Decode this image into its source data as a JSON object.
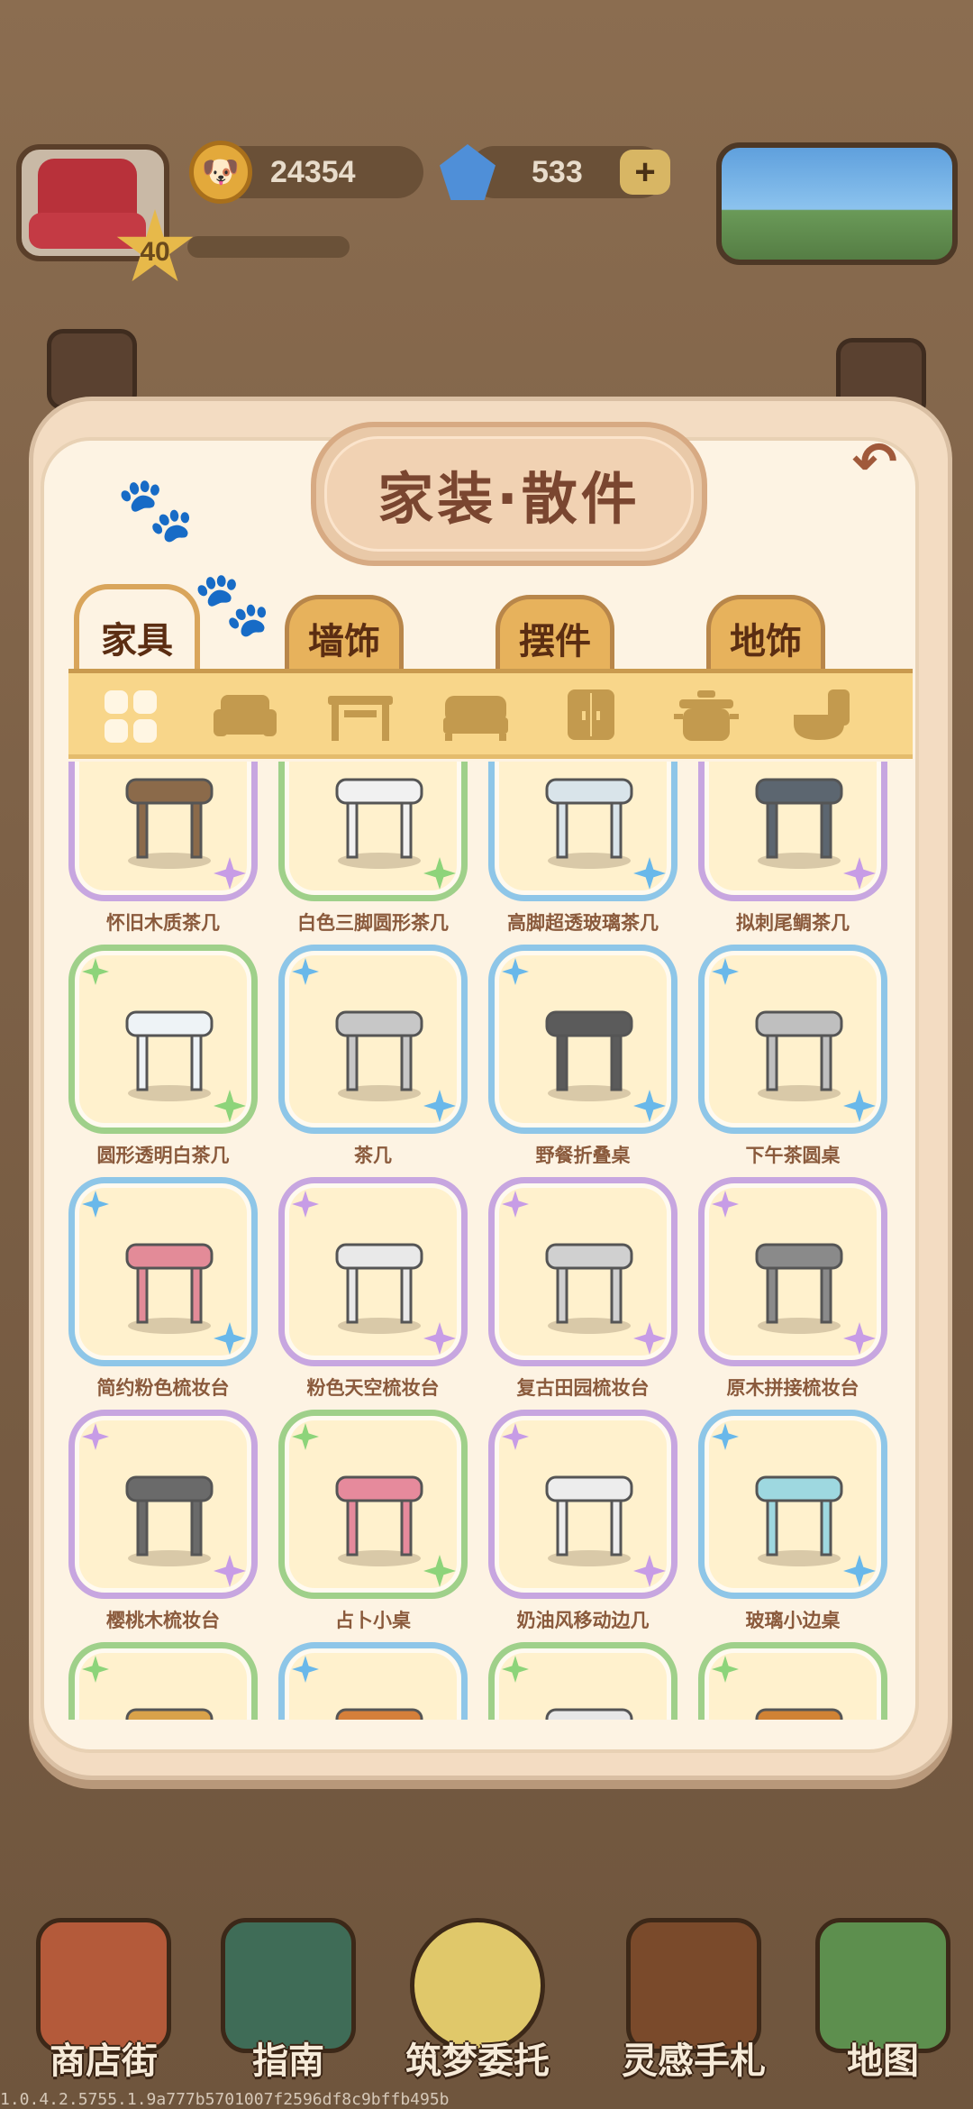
{
  "hud": {
    "level": "40",
    "coins": "24354",
    "gems": "533",
    "icons": {
      "avatar": "armchair-avatar",
      "coin": "dog-coin-icon",
      "gem": "diamond-icon",
      "plus": "plus-icon"
    }
  },
  "panel": {
    "title": "家装·散件",
    "back_icon": "undo-arrow-icon",
    "tabs": [
      {
        "label": "家具",
        "active": true
      },
      {
        "label": "墙饰",
        "active": false
      },
      {
        "label": "摆件",
        "active": false
      },
      {
        "label": "地饰",
        "active": false
      }
    ],
    "categories": [
      {
        "icon": "grid-all-icon",
        "active": true
      },
      {
        "icon": "sofa-icon",
        "active": false
      },
      {
        "icon": "table-icon",
        "active": false
      },
      {
        "icon": "bed-icon",
        "active": false
      },
      {
        "icon": "cabinet-icon",
        "active": false
      },
      {
        "icon": "pot-icon",
        "active": false
      },
      {
        "icon": "toilet-icon",
        "active": false
      }
    ],
    "items": [
      {
        "name": "怀旧木质茶几",
        "rarity": "purple"
      },
      {
        "name": "白色三脚圆形茶几",
        "rarity": "green"
      },
      {
        "name": "高脚超透玻璃茶几",
        "rarity": "blue"
      },
      {
        "name": "拟刺尾鲷茶几",
        "rarity": "purple"
      },
      {
        "name": "圆形透明白茶几",
        "rarity": "green"
      },
      {
        "name": "茶几",
        "rarity": "blue"
      },
      {
        "name": "野餐折叠桌",
        "rarity": "blue"
      },
      {
        "name": "下午茶圆桌",
        "rarity": "blue"
      },
      {
        "name": "简约粉色梳妆台",
        "rarity": "blue"
      },
      {
        "name": "粉色天空梳妆台",
        "rarity": "purple"
      },
      {
        "name": "复古田园梳妆台",
        "rarity": "purple"
      },
      {
        "name": "原木拼接梳妆台",
        "rarity": "purple"
      },
      {
        "name": "樱桃木梳妆台",
        "rarity": "purple"
      },
      {
        "name": "占卜小桌",
        "rarity": "green"
      },
      {
        "name": "奶油风移动边几",
        "rarity": "purple"
      },
      {
        "name": "玻璃小边桌",
        "rarity": "blue"
      },
      {
        "name": "",
        "rarity": "green"
      },
      {
        "name": "",
        "rarity": "blue"
      },
      {
        "name": "",
        "rarity": "green"
      },
      {
        "name": "",
        "rarity": "green"
      }
    ]
  },
  "nav": [
    {
      "label": "商店街",
      "icon": "shop-icon"
    },
    {
      "label": "指南",
      "icon": "guide-book-icon"
    },
    {
      "label": "筑梦委托",
      "icon": "notebook-icon"
    },
    {
      "label": "灵感手札",
      "icon": "quill-book-icon"
    },
    {
      "label": "地图",
      "icon": "map-pin-icon"
    }
  ],
  "build_code": "1.0.4.2.5755.1.9a777b5701007f2596df8c9bffb495b"
}
